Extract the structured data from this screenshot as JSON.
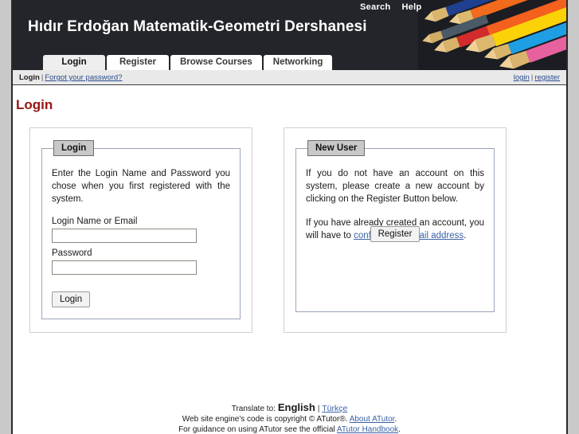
{
  "banner": {
    "site_title": "Hıdır Erdoğan Matematik-Geometri Dershanesi",
    "utility_links": [
      {
        "label": "Search",
        "name": "search-link"
      },
      {
        "label": "Help",
        "name": "help-link"
      }
    ],
    "artwork": "colored-pencils-photo"
  },
  "tabs": [
    {
      "label": "Login",
      "active": true
    },
    {
      "label": "Register",
      "active": false
    },
    {
      "label": "Browse Courses",
      "active": false
    },
    {
      "label": "Networking",
      "active": false
    }
  ],
  "breadcrumb": {
    "current": "Login",
    "separator": "|",
    "forgot_password": "Forgot your password?",
    "right_login": "login",
    "right_register": "register"
  },
  "page": {
    "title": "Login"
  },
  "login_panel": {
    "legend": "Login",
    "intro": "Enter the Login Name and Password you chose when you first registered with the system.",
    "login_label": "Login Name or Email",
    "login_value": "",
    "login_placeholder": "",
    "password_label": "Password",
    "password_value": "",
    "password_placeholder": "",
    "submit_label": "Login"
  },
  "newuser_panel": {
    "legend": "New User",
    "paragraph_1": "If you do not have an account on this system, please create a new account by clicking on the Register Button below.",
    "paragraph_2_before": "If you have already created an account, you will have to ",
    "paragraph_2_link": "confirm your email address",
    "paragraph_2_after": ".",
    "submit_label": "Register"
  },
  "footer": {
    "translate_label": "Translate to:",
    "lang_current": "English",
    "pipe": "|",
    "lang_other": "Türkçe",
    "copyright_before": "Web site engine's code is copyright © ATutor®. ",
    "copyright_link": "About ATutor",
    "copyright_after": ".",
    "guidance_before": "For guidance on using ATutor see the official ",
    "guidance_link": "ATutor Handbook",
    "guidance_after": "."
  },
  "colors": {
    "banner_bg": "#23252a",
    "title_red": "#9b1313",
    "link_blue": "#3a62a5",
    "legend_grey": "#c8c8c8",
    "gutter_grey": "#c9c9c9"
  }
}
